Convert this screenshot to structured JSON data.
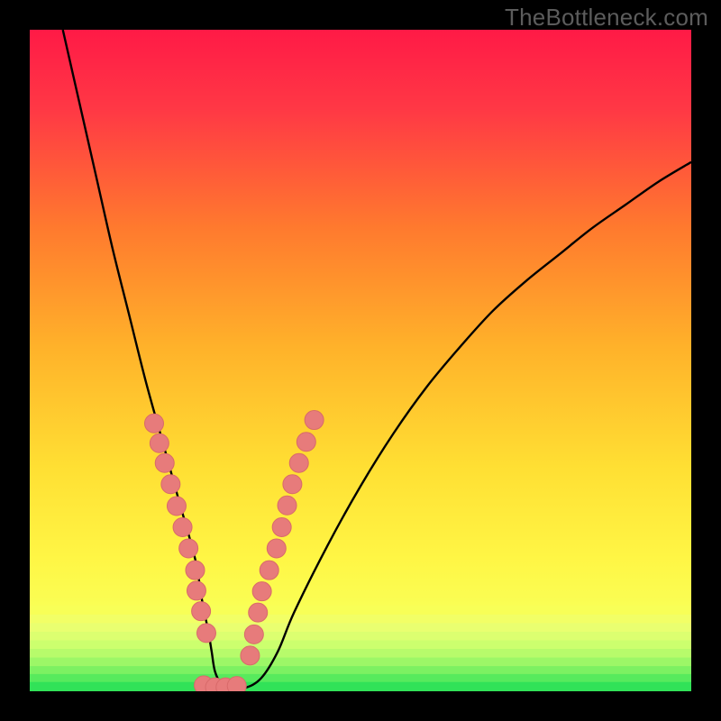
{
  "watermark": "TheBottleneck.com",
  "colors": {
    "frame": "#000000",
    "gradient_top": "#ff1a46",
    "gradient_mid1": "#ff8c1a",
    "gradient_mid2": "#ffee33",
    "gradient_mid3": "#f8ff4d",
    "gradient_band": "#f4ff66",
    "gradient_green": "#2fe65a",
    "curve": "#000000",
    "marker_fill": "#e77b7b",
    "marker_stroke": "#d86a6a"
  },
  "chart_data": {
    "type": "line",
    "title": "",
    "xlabel": "",
    "ylabel": "",
    "xlim": [
      0,
      100
    ],
    "ylim": [
      0,
      100
    ],
    "series": [
      {
        "name": "bottleneck-curve",
        "x": [
          5,
          7.5,
          10,
          12.5,
          15,
          17.5,
          20,
          22.5,
          25,
          26,
          27,
          27.5,
          28,
          29,
          30,
          32.5,
          35,
          37.5,
          40,
          45,
          50,
          55,
          60,
          65,
          70,
          75,
          80,
          85,
          90,
          95,
          100
        ],
        "y": [
          100,
          89,
          78,
          67,
          57,
          47,
          38,
          29,
          20,
          14,
          9,
          6,
          3,
          1,
          0.5,
          0.5,
          2,
          6,
          12,
          22,
          31,
          39,
          46,
          52,
          57.5,
          62,
          66,
          70,
          73.5,
          77,
          80
        ]
      }
    ],
    "markers": [
      {
        "x": 18.8,
        "y": 40.5
      },
      {
        "x": 19.6,
        "y": 37.5
      },
      {
        "x": 20.4,
        "y": 34.5
      },
      {
        "x": 21.3,
        "y": 31.3
      },
      {
        "x": 22.2,
        "y": 28.0
      },
      {
        "x": 23.1,
        "y": 24.8
      },
      {
        "x": 24.0,
        "y": 21.6
      },
      {
        "x": 25.0,
        "y": 18.3
      },
      {
        "x": 25.2,
        "y": 15.2
      },
      {
        "x": 25.9,
        "y": 12.1
      },
      {
        "x": 26.7,
        "y": 8.8
      },
      {
        "x": 26.3,
        "y": 0.9
      },
      {
        "x": 28.0,
        "y": 0.6
      },
      {
        "x": 29.6,
        "y": 0.6
      },
      {
        "x": 31.3,
        "y": 0.8
      },
      {
        "x": 33.3,
        "y": 5.4
      },
      {
        "x": 33.9,
        "y": 8.6
      },
      {
        "x": 34.5,
        "y": 11.9
      },
      {
        "x": 35.1,
        "y": 15.1
      },
      {
        "x": 36.2,
        "y": 18.3
      },
      {
        "x": 37.3,
        "y": 21.6
      },
      {
        "x": 38.1,
        "y": 24.8
      },
      {
        "x": 38.9,
        "y": 28.1
      },
      {
        "x": 39.7,
        "y": 31.3
      },
      {
        "x": 40.7,
        "y": 34.5
      },
      {
        "x": 41.8,
        "y": 37.7
      },
      {
        "x": 43.0,
        "y": 41.0
      }
    ],
    "bottom_bands": [
      {
        "y_top": 13.0,
        "color": "#f8ff57"
      },
      {
        "y_top": 11.6,
        "color": "#f2ff66"
      },
      {
        "y_top": 10.3,
        "color": "#e9ff70"
      },
      {
        "y_top": 9.0,
        "color": "#dcff70"
      },
      {
        "y_top": 7.7,
        "color": "#ccff6e"
      },
      {
        "y_top": 6.4,
        "color": "#b7fb6b"
      },
      {
        "y_top": 5.1,
        "color": "#9cf767"
      },
      {
        "y_top": 3.8,
        "color": "#7cf162"
      },
      {
        "y_top": 2.6,
        "color": "#57ea5d"
      },
      {
        "y_top": 1.4,
        "color": "#31e258"
      }
    ]
  }
}
